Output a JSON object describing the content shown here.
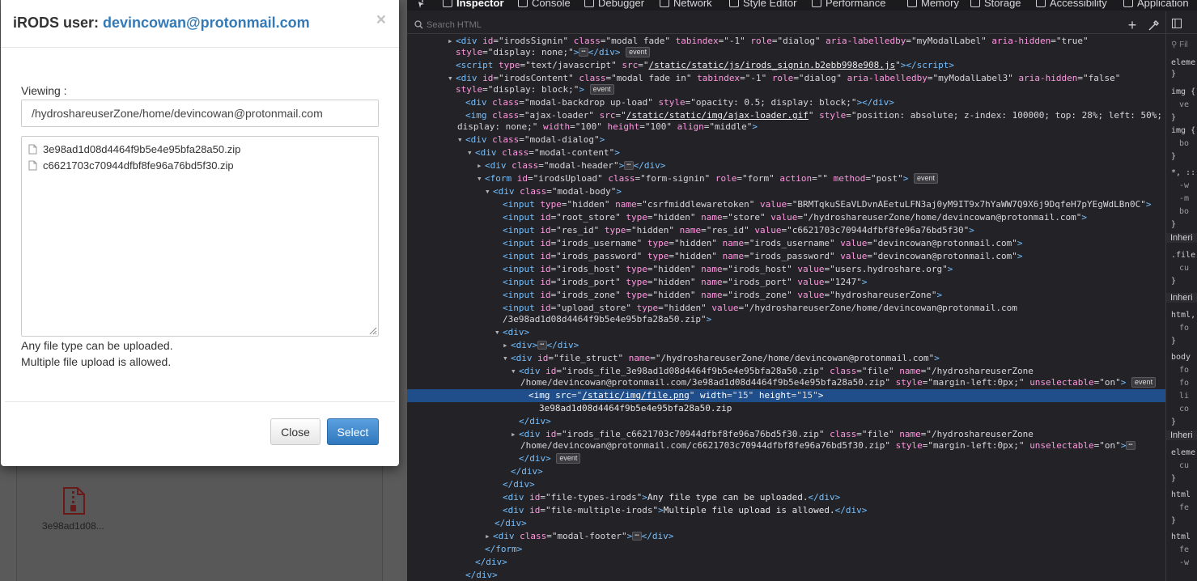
{
  "modal": {
    "title_prefix": "iRODS user: ",
    "user": "devincowan@protonmail.com",
    "close_glyph": "×",
    "viewing_label": "Viewing :",
    "path_value": "/hydroshareuserZone/home/devincowan@protonmail.com",
    "files": [
      {
        "name": "3e98ad1d08d4464f9b5e4e95bfa28a50.zip",
        "icon": "file-icon"
      },
      {
        "name": "c6621703c70944dfbf8fe96a76bd5f30.zip",
        "icon": "file-icon"
      }
    ],
    "types_text": "Any file type can be uploaded.",
    "multiple_text": "Multiple file upload is allowed.",
    "close_button": "Close",
    "select_button": "Select"
  },
  "background": {
    "file_label": "3e98ad1d08...",
    "file_icon": "zip-file-icon"
  },
  "devtools": {
    "tabs": [
      "Inspector",
      "Console",
      "Debugger",
      "Network",
      "Style Editor",
      "Performance",
      "Memory",
      "Storage",
      "Accessibility",
      "Application"
    ],
    "active_tab": "Inspector",
    "search_placeholder": "Search HTML",
    "tree": {
      "l1": {
        "id": "irodsSignin",
        "cls": "modal fade",
        "tabindex": "-1",
        "role": "dialog",
        "labelledby": "myModalLabel",
        "hidden": "true"
      },
      "l1b": "display: none;",
      "l2_src": "/static/static/js/irods_signin.b2ebb998e908.js",
      "l3": {
        "id": "irodsContent",
        "cls": "modal fade in",
        "tabindex": "-1",
        "role": "dialog",
        "labelledby": "myModalLabel3",
        "hidden": "false"
      },
      "l3b": "display: block;",
      "l4": {
        "cls": "modal-backdrop up-load",
        "style": "opacity: 0.5; display: block;"
      },
      "l5": {
        "cls": "ajax-loader",
        "src": "/static/static/img/ajax-loader.gif",
        "style": "position: absolute; z-index: 100000; top: 28%; left: 50%;"
      },
      "l5b": {
        "style": "display: none;",
        "width": "100",
        "height": "100",
        "align": "middle"
      },
      "l6": "modal-dialog",
      "l7": "modal-content",
      "l8": "modal-header",
      "l9": {
        "id": "irodsUpload",
        "cls": "form-signin",
        "role": "form",
        "action": "",
        "method": "post"
      },
      "l10": "modal-body",
      "inputs": [
        {
          "pre": "type=",
          "a1": "hidden",
          "mid": " name=",
          "a2": "csrfmiddlewaretoken",
          "end": " value=",
          "a3": "BRMTqkuSEaVLDvnAEetuLFN3aj0yM9IT9x7hYaWW7Q9X6j9DqfeH7pYEgWdLBn0C"
        },
        {
          "pre": "id=",
          "a1": "root_store",
          "mid": " type=\"hidden\" name=",
          "a2": "store",
          "end": " value=",
          "a3": "/hydroshareuserZone/home/devincowan@protonmail.com"
        },
        {
          "pre": "id=",
          "a1": "res_id",
          "mid": " type=\"hidden\" name=",
          "a2": "res_id",
          "end": " value=",
          "a3": "c6621703c70944dfbf8fe96a76bd5f30"
        },
        {
          "pre": "id=",
          "a1": "irods_username",
          "mid": " type=\"hidden\" name=",
          "a2": "irods_username",
          "end": " value=",
          "a3": "devincowan@protonmail.com"
        },
        {
          "pre": "id=",
          "a1": "irods_password",
          "mid": " type=\"hidden\" name=",
          "a2": "irods_password",
          "end": " value=",
          "a3": "devincowan@protonmail.com"
        },
        {
          "pre": "id=",
          "a1": "irods_host",
          "mid": " type=\"hidden\" name=",
          "a2": "irods_host",
          "end": " value=",
          "a3": "users.hydroshare.org"
        },
        {
          "pre": "id=",
          "a1": "irods_port",
          "mid": " type=\"hidden\" name=",
          "a2": "irods_port",
          "end": " value=",
          "a3": "1247"
        },
        {
          "pre": "id=",
          "a1": "irods_zone",
          "mid": " type=\"hidden\" name=",
          "a2": "irods_zone",
          "end": " value=",
          "a3": "hydroshareuserZone"
        }
      ],
      "upload_store_val1": "/hydroshareuserZone/home/devincowan@protonmail.com",
      "upload_store_val2": "/3e98ad1d08d4464f9b5e4e95bfa28a50.zip",
      "file_struct": {
        "id": "file_struct",
        "name": "/hydroshareuserZone/home/devincowan@protonmail.com"
      },
      "file1": {
        "id": "irods_file_3e98ad1d08d4464f9b5e4e95bfa28a50.zip",
        "cls": "file",
        "name1": "/hydroshareuserZone",
        "name2": "/home/devincowan@protonmail.com/3e98ad1d08d4464f9b5e4e95bfa28a50.zip",
        "style": "margin-left:0px;",
        "unsel": "on"
      },
      "img": {
        "src": "/static/img/file.png",
        "width": "15",
        "height": "15"
      },
      "file1_text": "3e98ad1d08d4464f9b5e4e95bfa28a50.zip",
      "file2": {
        "id": "irods_file_c6621703c70944dfbf8fe96a76bd5f30.zip",
        "cls": "file",
        "name1": "/hydroshareuserZone",
        "name2": "/home/devincowan@protonmail.com/c6621703c70944dfbf8fe96a76bd5f30.zip",
        "style": "margin-left:0px;",
        "unsel": "on"
      },
      "types": {
        "id": "file-types-irods",
        "text": "Any file type can be uploaded."
      },
      "multi": {
        "id": "file-multiple-irods",
        "text": "Multiple file upload is allowed."
      },
      "footer": "modal-footer",
      "event": "event",
      "ellipsis": "⋯"
    },
    "rules": {
      "filter": "Fil",
      "lines": [
        "eleme",
        "}",
        "img {",
        "ve",
        "}",
        "img {",
        "bo",
        "}",
        "*, ::",
        "-w",
        "-m",
        "bo",
        "}"
      ],
      "inherited": [
        "Inheri",
        ".file",
        "cu",
        "}",
        "Inheri",
        "html,",
        "fo",
        "}",
        "body",
        "fo",
        "fo",
        "li",
        "co",
        "}",
        "Inheri",
        "eleme",
        "cu",
        "}",
        "html",
        "fe",
        "}",
        "html",
        "fe",
        "-w"
      ]
    }
  }
}
